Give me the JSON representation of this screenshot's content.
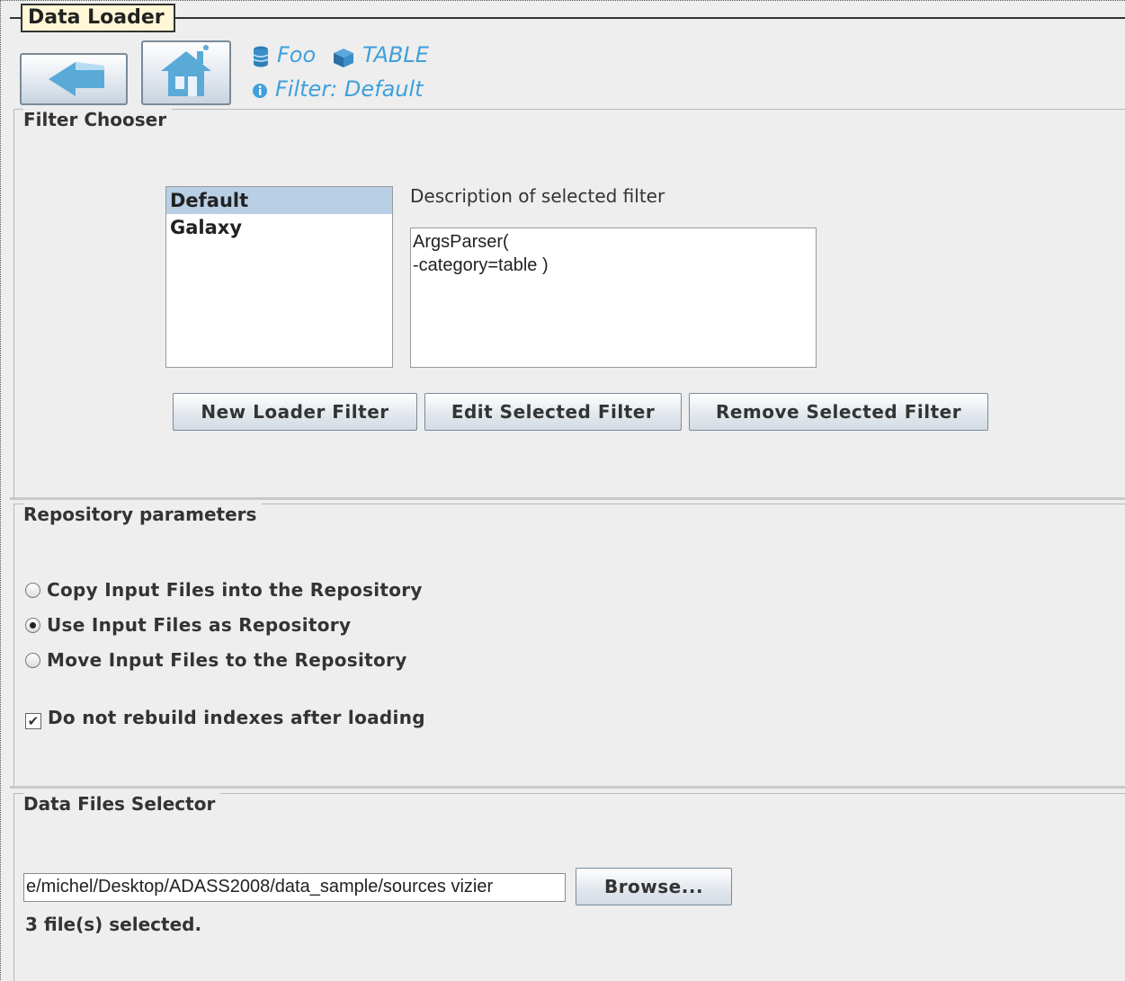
{
  "window": {
    "title": "Data Loader"
  },
  "toolbar": {
    "back_icon": "back-arrow-icon",
    "home_icon": "home-icon",
    "database_name": "Foo",
    "category_name": "TABLE",
    "filter_label": "Filter: Default"
  },
  "filter_chooser": {
    "title": "Filter Chooser",
    "filters": [
      {
        "label": "Default",
        "selected": true
      },
      {
        "label": "Galaxy",
        "selected": false
      }
    ],
    "description_label": "Description of selected filter",
    "description_text": "ArgsParser(\n-category=table )",
    "buttons": {
      "new": "New Loader Filter",
      "edit": "Edit Selected Filter",
      "remove": "Remove Selected Filter"
    }
  },
  "repository": {
    "title": "Repository parameters",
    "options": [
      {
        "label": "Copy Input Files into the Repository",
        "selected": false
      },
      {
        "label": "Use Input Files as Repository",
        "selected": true
      },
      {
        "label": "Move Input Files to the Repository",
        "selected": false
      }
    ],
    "no_rebuild_label": "Do not rebuild indexes after loading",
    "no_rebuild_checked": true
  },
  "data_files": {
    "title": "Data Files Selector",
    "path_value": "e/michel/Desktop/ADASS2008/data_sample/sources vizier",
    "browse_label": "Browse...",
    "status": "3 file(s) selected."
  },
  "colors": {
    "accent": "#3fa0dc",
    "selection": "#b8cfe5",
    "title_tab_bg": "#fff7d6"
  }
}
